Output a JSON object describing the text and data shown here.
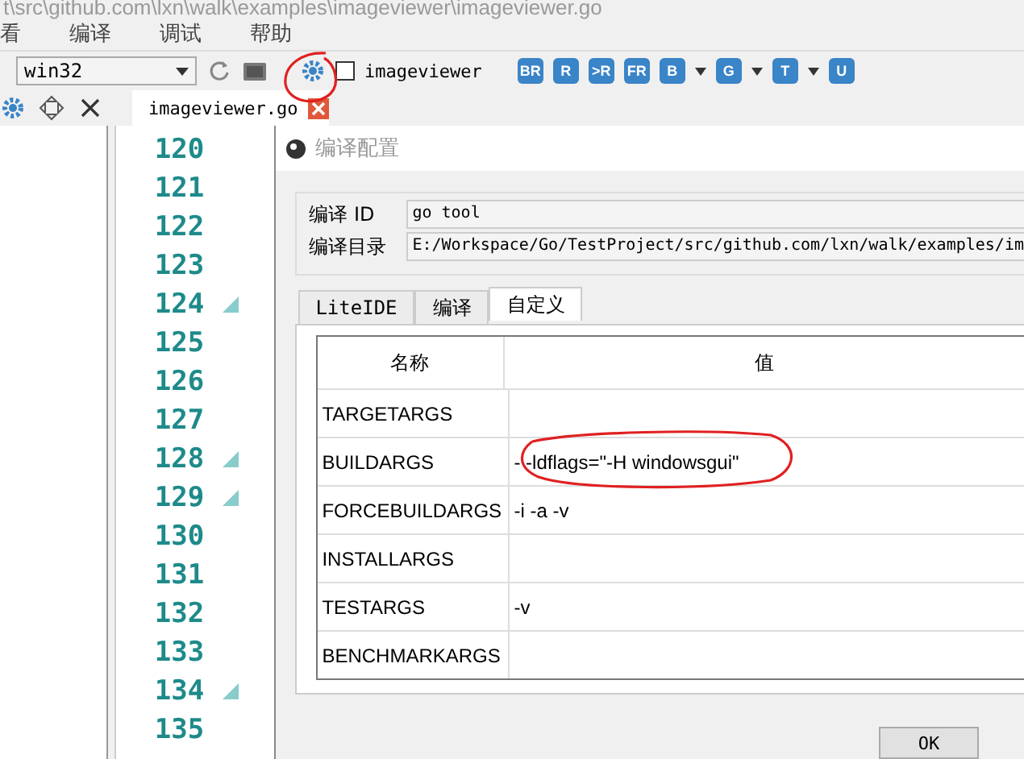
{
  "title_path": "t\\src\\github.com\\lxn\\walk\\examples\\imageviewer\\imageviewer.go",
  "menu": [
    "看",
    "编译",
    "调试",
    "帮助"
  ],
  "toolbar": {
    "target": "win32",
    "project": {
      "label": "imageviewer",
      "checked": false
    },
    "buttons": [
      {
        "label": "BR",
        "dropdown": false
      },
      {
        "label": "R",
        "dropdown": false
      },
      {
        "label": ">R",
        "dropdown": false
      },
      {
        "label": "FR",
        "dropdown": false
      },
      {
        "label": "B",
        "dropdown": true
      },
      {
        "label": "G",
        "dropdown": true
      },
      {
        "label": "T",
        "dropdown": true
      },
      {
        "label": "U",
        "dropdown": false
      }
    ]
  },
  "editor": {
    "tab": "imageviewer.go",
    "lines": [
      {
        "number": "120",
        "fold": false
      },
      {
        "number": "121",
        "fold": false
      },
      {
        "number": "122",
        "fold": false
      },
      {
        "number": "123",
        "fold": false
      },
      {
        "number": "124",
        "fold": true
      },
      {
        "number": "125",
        "fold": false
      },
      {
        "number": "126",
        "fold": false
      },
      {
        "number": "127",
        "fold": false
      },
      {
        "number": "128",
        "fold": true
      },
      {
        "number": "129",
        "fold": true
      },
      {
        "number": "130",
        "fold": false
      },
      {
        "number": "131",
        "fold": false
      },
      {
        "number": "132",
        "fold": false
      },
      {
        "number": "133",
        "fold": false
      },
      {
        "number": "134",
        "fold": true
      },
      {
        "number": "135",
        "fold": false
      }
    ]
  },
  "dialog": {
    "title": "编译配置",
    "id_label": "编译 ID",
    "id_value": "go tool",
    "dir_label": "编译目录",
    "dir_value": "E:/Workspace/Go/TestProject/src/github.com/lxn/walk/examples/im",
    "tabs": [
      {
        "label": "LiteIDE",
        "selected": false
      },
      {
        "label": "编译",
        "selected": false
      },
      {
        "label": "自定义",
        "selected": true
      }
    ],
    "table": {
      "columns": [
        "名称",
        "值"
      ],
      "rows": [
        {
          "name": "TARGETARGS",
          "value": ""
        },
        {
          "name": "BUILDARGS",
          "value": "-  -ldflags=\"-H windowsgui\""
        },
        {
          "name": "FORCEBUILDARGS",
          "value": "-i -a -v"
        },
        {
          "name": "INSTALLARGS",
          "value": ""
        },
        {
          "name": "TESTARGS",
          "value": "-v"
        },
        {
          "name": "BENCHMARKARGS",
          "value": ""
        }
      ]
    },
    "buttons": [
      "OK"
    ]
  }
}
